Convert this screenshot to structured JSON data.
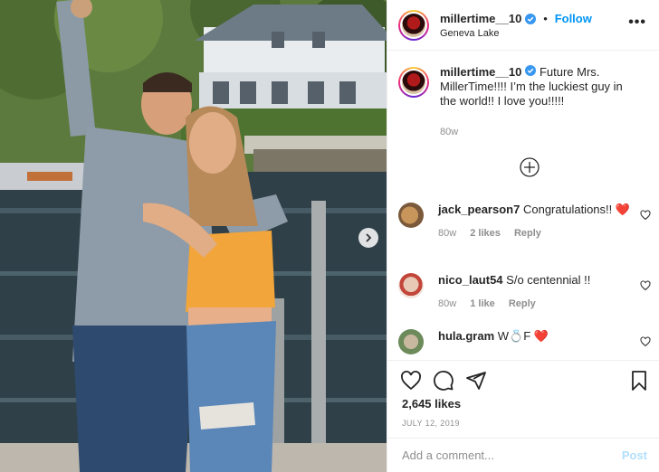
{
  "post": {
    "username": "millertime__10",
    "follow_label": "Follow",
    "separator": "•",
    "location": "Geneva Lake",
    "more_label": "•••"
  },
  "caption": {
    "username": "millertime__10",
    "text": "Future Mrs. MillerTime!!!! I’m the luckiest guy in the world!! I love you!!!!!",
    "age": "80w"
  },
  "comments": [
    {
      "username": "jack_pearson7",
      "text": "Congratulations!! ❤️",
      "age": "80w",
      "likes": "2 likes",
      "reply": "Reply"
    },
    {
      "username": "nico_laut54",
      "text": "S/o centennial !!",
      "age": "80w",
      "likes": "1 like",
      "reply": "Reply"
    },
    {
      "username": "hula.gram",
      "text": "W💍F ❤️"
    }
  ],
  "footer": {
    "likes": "2,645 likes",
    "date": "JULY 12, 2019",
    "comment_placeholder": "Add a comment...",
    "post_label": "Post"
  },
  "icons": [
    "verified-badge-icon",
    "heart-icon",
    "comment-icon",
    "share-icon",
    "bookmark-icon",
    "plus-circle-icon",
    "chevron-right-icon",
    "more-icon"
  ],
  "colors": {
    "link_blue": "#0095f6",
    "muted": "#8e8e8e",
    "post_disabled": "#b2dffc",
    "heart_red": "#ed4956"
  }
}
